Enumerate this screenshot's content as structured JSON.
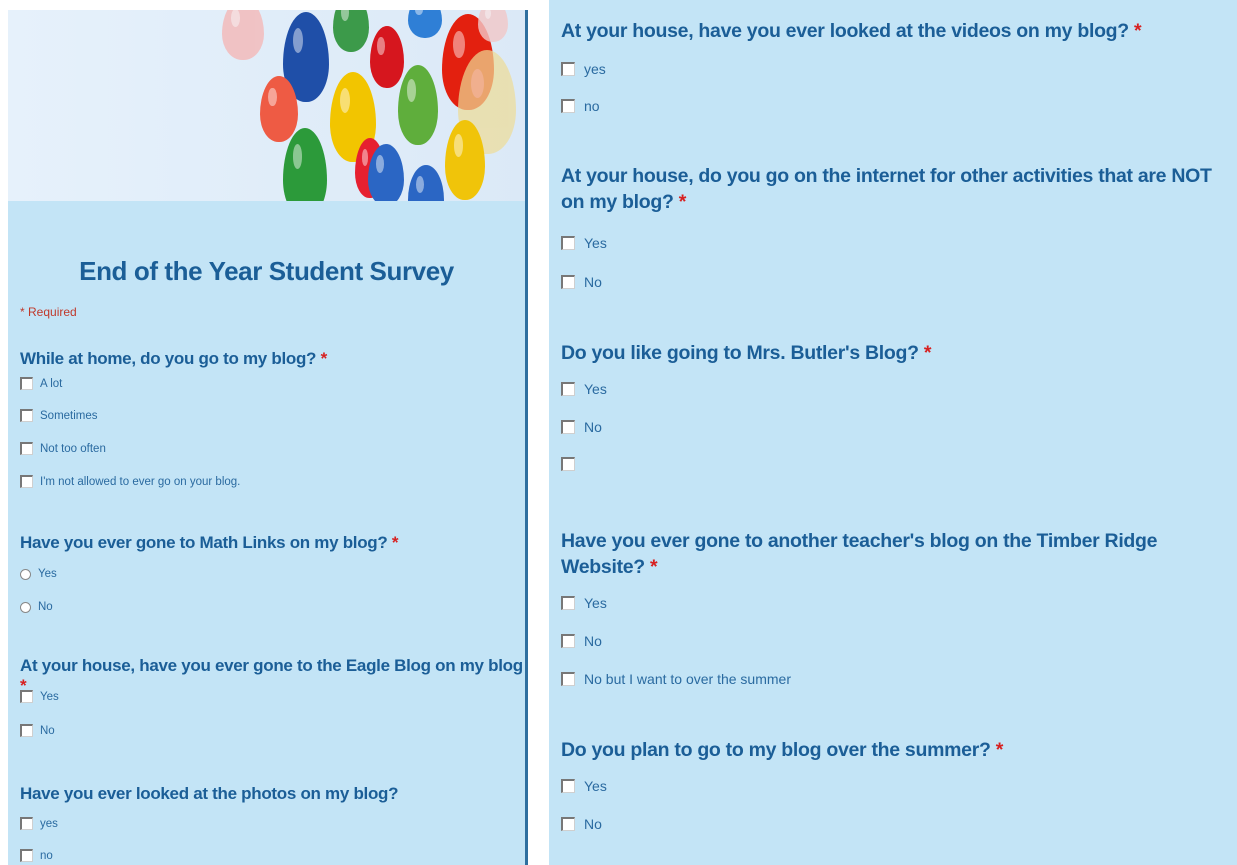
{
  "survey": {
    "title": "End of the Year Student Survey",
    "required_note": "* Required",
    "required_marker": "*"
  },
  "questions": [
    {
      "text": "While at home, do you go to my blog?",
      "required": true,
      "input_type": "checkbox",
      "options": [
        "A lot",
        "Sometimes",
        "Not too often",
        "I'm not allowed to ever go on your blog."
      ]
    },
    {
      "text": "Have you ever gone to Math Links on my blog?",
      "required": true,
      "input_type": "radio",
      "options": [
        "Yes",
        "No"
      ]
    },
    {
      "text": "At your house, have you ever gone to the Eagle Blog on my blog",
      "required": true,
      "input_type": "checkbox",
      "options": [
        "Yes",
        "No"
      ]
    },
    {
      "text": "Have you ever looked at the photos on my blog?",
      "required": false,
      "input_type": "checkbox",
      "options": [
        "yes",
        "no"
      ]
    },
    {
      "text": "At your house, have you ever looked at the videos on my blog?",
      "required": true,
      "input_type": "checkbox",
      "options": [
        "yes",
        "no"
      ]
    },
    {
      "text": "At your house, do you go on the internet for other activities that are NOT on my blog?",
      "required": true,
      "input_type": "checkbox",
      "options": [
        "Yes",
        "No"
      ]
    },
    {
      "text": "Do you like going to Mrs. Butler's Blog?",
      "required": true,
      "input_type": "checkbox",
      "options": [
        "Yes",
        "No",
        ""
      ]
    },
    {
      "text": "Have you ever gone to another teacher's blog on the Timber Ridge Website?",
      "required": true,
      "input_type": "checkbox",
      "options": [
        "Yes",
        "No",
        "No but I want to over the summer"
      ]
    },
    {
      "text": "Do you plan to go to my blog over the summer?",
      "required": true,
      "input_type": "checkbox",
      "options": [
        "Yes",
        "No"
      ]
    }
  ],
  "colors": {
    "panel_background": "#c3e4f6",
    "question_text": "#1b5e97",
    "option_text": "#2a6aa0",
    "required_star": "#d72020"
  },
  "icons": [
    "balloons-banner",
    "checkbox-icon",
    "radio-icon"
  ]
}
